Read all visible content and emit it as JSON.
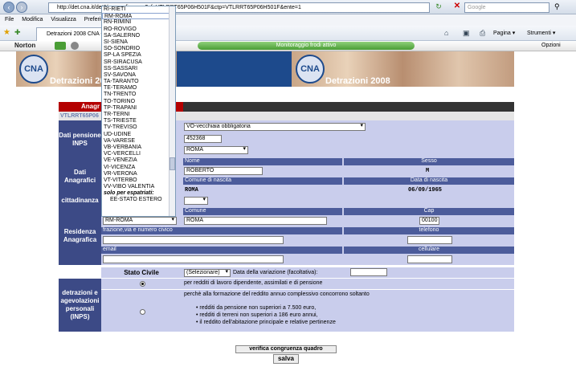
{
  "browser": {
    "url": "http://det.cna.it/det3/anagrafica.asp?cf=VTLRRT65P06H501F&ctp=VTLRRT65P06H501F&ente=1",
    "search_placeholder": "Google",
    "menu": [
      "File",
      "Modifica",
      "Visualizza",
      "Preferiti"
    ],
    "tab_title": "Detrazioni 2008 CNA - An",
    "toolbar": {
      "page": "Pagina",
      "tools": "Strumenti"
    },
    "norton": "Norton",
    "monitor": "Monitoraggio frodi attivo",
    "options": "Opzioni"
  },
  "banner": {
    "title_left": "Detrazioni 2008",
    "title_right": "Detrazioni 2008",
    "logo": "CNA"
  },
  "form": {
    "tab_label": "Anagr",
    "id_line": "VTLRRT65P06",
    "sections": {
      "pensione": "Dati pensione INPS",
      "anagrafici": "Dati Anagrafici",
      "cittadinanza": "cittadinanza",
      "residenza": "Residenza Anagrafica",
      "stato_civile": "Stato Civile",
      "detrazioni": "detrazioni e agevolazioni personali (INPS)"
    },
    "pension_type": "VO-vecchiaia obbligatoria",
    "pension_number": "452368",
    "pension_province": "ROMA",
    "headers": {
      "nome": "Nome",
      "sesso": "Sesso",
      "comune_nascita": "Comune di nascita",
      "data_nascita": "Data di nascita",
      "comune": "Comune",
      "cap": "Cap",
      "frazione": "frazione,via e numero civico",
      "telefono": "telefono",
      "email": "email",
      "cellulare": "cellulare"
    },
    "nome": "ROBERTO",
    "sesso": "M",
    "comune_nascita": "ROMA",
    "data_nascita": "06/09/1965",
    "res_provincia": "RM-ROMA",
    "res_comune": "ROMA",
    "cap": "00100",
    "stato_civile": "(Selezionare)",
    "data_variazione_label": "Data della variazione (facoltativa):",
    "detr_option1": "per redditi di lavoro dipendente, assimilati e di pensione",
    "detr_option2": "perchè alla formazione del reddito annuo complessivo concorrono soltanto",
    "detr_bullets": [
      "redditi da pensione non superiori a 7.500 euro,",
      "redditi di terreni non superiori a 186 euro annui,",
      "il reddito dell'abitazione principale e relative pertinenze"
    ],
    "verify_button": "verifica congruenza quadro",
    "save_button": "salva"
  },
  "dropdown": {
    "options": [
      "RI-RIETI",
      "RM-ROMA",
      "RN-RIMINI",
      "RO-ROVIGO",
      "SA-SALERNO",
      "SI-SIENA",
      "SO-SONDRIO",
      "SP-LA SPEZIA",
      "SR-SIRACUSA",
      "SS-SASSARI",
      "SV-SAVONA",
      "TA-TARANTO",
      "TE-TERAMO",
      "TN-TRENTO",
      "TO-TORINO",
      "TP-TRAPANI",
      "TR-TERNI",
      "TS-TRIESTE",
      "TV-TREVISO",
      "UD-UDINE",
      "VA-VARESE",
      "VB-VERBANIA",
      "VC-VERCELLI",
      "VE-VENEZIA",
      "VI-VICENZA",
      "VR-VERONA",
      "VT-VITERBO",
      "VV-VIBO VALENTIA"
    ],
    "group_label": "solo per espatriati:",
    "estero": "EE-STATO ESTERO"
  }
}
